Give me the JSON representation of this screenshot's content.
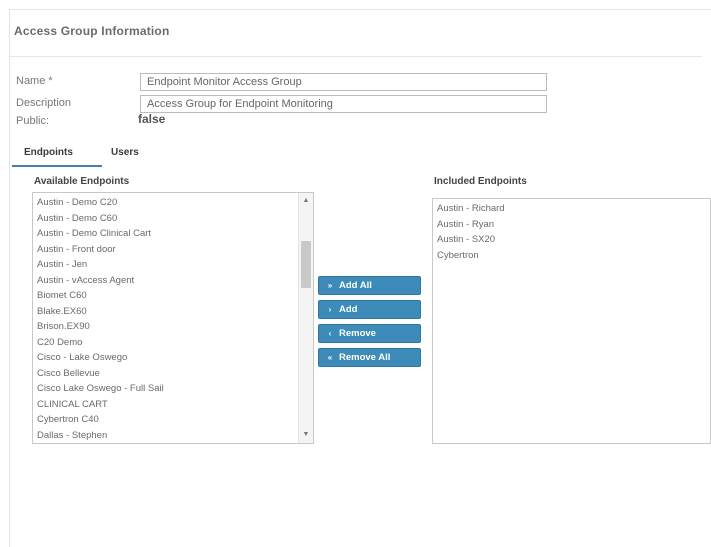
{
  "section_title": "Access Group Information",
  "form": {
    "name_label": "Name *",
    "name_value": "Endpoint Monitor Access Group",
    "description_label": "Description",
    "description_value": "Access Group for Endpoint Monitoring",
    "public_label": "Public:",
    "public_value": "false"
  },
  "tabs": [
    {
      "label": "Endpoints",
      "active": true
    },
    {
      "label": "Users",
      "active": false
    }
  ],
  "available": {
    "title": "Available Endpoints",
    "items": [
      "Austin - Demo C20",
      "Austin - Demo C60",
      "Austin - Demo Clinical Cart",
      "Austin - Front door",
      "Austin - Jen",
      "Austin - vAccess Agent",
      "Biomet C60",
      "Blake.EX60",
      "Brison.EX90",
      "C20 Demo",
      "Cisco - Lake Oswego",
      "Cisco Bellevue",
      "Cisco Lake Oswego - Full Sail",
      "CLINICAL CART",
      "Cybertron C40",
      "Dallas - Stephen"
    ]
  },
  "included": {
    "title": "Included Endpoints",
    "items": [
      "Austin - Richard",
      "Austin - Ryan",
      "Austin - SX20",
      "Cybertron"
    ]
  },
  "buttons": {
    "add_all": "Add All",
    "add": "Add",
    "remove": "Remove",
    "remove_all": "Remove All"
  },
  "icons": {
    "add_all": "double-chevron-right-icon",
    "add": "chevron-right-icon",
    "remove": "chevron-left-icon",
    "remove_all": "double-chevron-left-icon"
  },
  "colors": {
    "button_blue": "#3d8bb8",
    "tab_underline": "#4a7ea5"
  }
}
